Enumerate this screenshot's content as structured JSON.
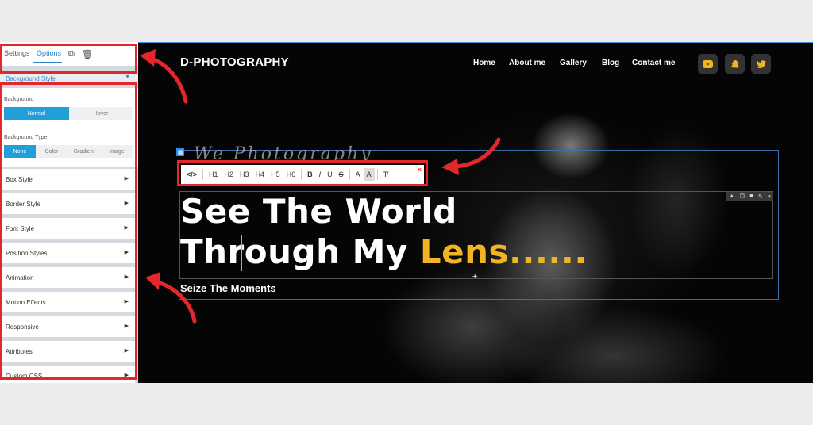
{
  "panel": {
    "tabs": {
      "settings": "Settings",
      "options": "Options"
    },
    "tool_icons": {
      "copy": "⧉",
      "delete": "🗑"
    },
    "section": {
      "label": "Background Style",
      "caret": "▼"
    },
    "background": {
      "label": "Background",
      "state_options": [
        "Normal",
        "Hover"
      ],
      "active_state": "Normal",
      "type_label": "Background Type",
      "type_options": [
        "None",
        "Color",
        "Gradient",
        "Image"
      ],
      "active_type": "None"
    },
    "accordions": [
      "Box Style",
      "Border Style",
      "Font Style",
      "Position Styles",
      "Animation",
      "Motion Effects",
      "Responsive",
      "Attributes",
      "Custom CSS"
    ],
    "accordion_arrow": "▶",
    "collapse_glyph": "‹"
  },
  "site": {
    "brand": "D-PHOTOGRAPHY",
    "nav": [
      "Home",
      "About me",
      "Gallery",
      "Blog",
      "Contact me"
    ],
    "social_icons": [
      "youtube-icon",
      "snapchat-icon",
      "twitter-icon"
    ],
    "social_color": "#f0b424",
    "script_text": "We Photography",
    "heading_line1": "See The World",
    "heading_line2_prefix": "Through My ",
    "heading_accent": "Lens......",
    "subheading": "Seize The Moments"
  },
  "toolbar": {
    "code": "</>",
    "headings": [
      "H1",
      "H2",
      "H3",
      "H4",
      "H5",
      "H6"
    ],
    "bold": "B",
    "italic": "I",
    "underline": "U",
    "strike": "S",
    "font_color": "A",
    "bg_color": "A",
    "clear_format": "T̸",
    "close": "×"
  },
  "colors": {
    "accent": "#f0b424",
    "primary": "#21a0d8",
    "annotation": "#e3272a"
  }
}
